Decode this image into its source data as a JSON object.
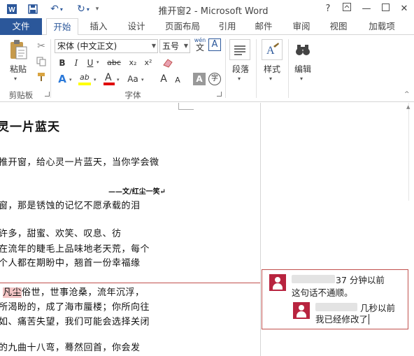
{
  "window": {
    "title": "推开窗2 - Microsoft Word",
    "help_btn": "?"
  },
  "tabs": [
    "文件",
    "开始",
    "插入",
    "设计",
    "页面布局",
    "引用",
    "邮件",
    "审阅",
    "视图",
    "加载项"
  ],
  "ribbon": {
    "clipboard": {
      "paste_label": "粘贴",
      "group_label": "剪贴板"
    },
    "font": {
      "font_name": "宋体 (中文正文)",
      "font_size": "五号",
      "wen_label": "wén",
      "wen_char": "文",
      "bold": "B",
      "italic": "I",
      "underline": "U",
      "strike": "abc",
      "subscript": "x₂",
      "superscript": "x²",
      "text_effects": "A",
      "highlight": "ab",
      "font_color": "A",
      "change_case": "Aa",
      "grow": "A",
      "shrink": "A",
      "char_shading": "A",
      "enclose": "字",
      "border_char": "A",
      "group_label": "字体"
    },
    "paragraph": {
      "label": "段落"
    },
    "styles": {
      "label": "样式"
    },
    "editing": {
      "label": "编辑"
    }
  },
  "document": {
    "title": "灵一片蓝天",
    "lines": [
      "推开窗，给心灵一片蓝天，当你学会微",
      "窗，那是锈蚀的记忆不愿承载的泪",
      "许多，甜蜜、欢笑、叹息、彷",
      "在流年的睫毛上品味地老天荒，每个",
      "个人都在期盼中，翘首一份幸福缘"
    ],
    "author": "——文/红尘一笑",
    "line_hl_pre": "",
    "line_hl_word": "凡尘",
    "line_hl_post": "俗世，世事沧桑，流年沉浮，",
    "lines2": [
      "所渴盼的，成了海市蜃楼；你所向往",
      "如、痛苦失望，我们可能会选择关闭",
      "",
      "的九曲十八弯，蓦然回首，你会发"
    ]
  },
  "comments": {
    "first": {
      "time_suffix": "37 分钟以前",
      "text": "这句话不通顺。"
    },
    "reply": {
      "time": "几秒以前",
      "text": "我已经修改了"
    }
  },
  "colors": {
    "accent": "#2b579a",
    "comment_border": "#c0504d",
    "highlight": "#f3c5c5",
    "avatar": "#b8243f"
  }
}
